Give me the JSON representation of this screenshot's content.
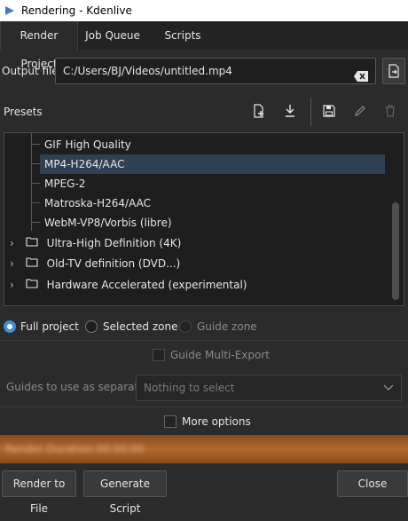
{
  "window": {
    "title": "Rendering - Kdenlive"
  },
  "tabs": [
    "Render Project",
    "Job Queue",
    "Scripts"
  ],
  "output": {
    "label": "Output file",
    "value": "C:/Users/BJ/Videos/untitled.mp4"
  },
  "presets": {
    "label": "Presets",
    "items": [
      "GIF High Quality",
      "MP4-H264/AAC",
      "MPEG-2",
      "Matroska-H264/AAC",
      "WebM-VP8/Vorbis (libre)"
    ],
    "selected": "MP4-H264/AAC",
    "folders": [
      "Ultra-High Definition (4K)",
      "Old-TV definition (DVD...)",
      "Hardware Accelerated (experimental)"
    ]
  },
  "range": {
    "options": [
      "Full project",
      "Selected zone",
      "Guide zone"
    ],
    "selected": "Full project"
  },
  "guides": {
    "multi_export_label": "Guide Multi-Export",
    "separator_label": "Guides to use as separator:",
    "separator_placeholder": "Nothing to select"
  },
  "more_options_label": "More options",
  "progress": {
    "text": "Render Duration 00:00:00",
    "accent": "#b06a2e"
  },
  "buttons": {
    "render": "Render to File",
    "script": "Generate Script",
    "close": "Close"
  },
  "colors": {
    "selection": "#2f4152",
    "radio_active": "#3d8fd6"
  }
}
